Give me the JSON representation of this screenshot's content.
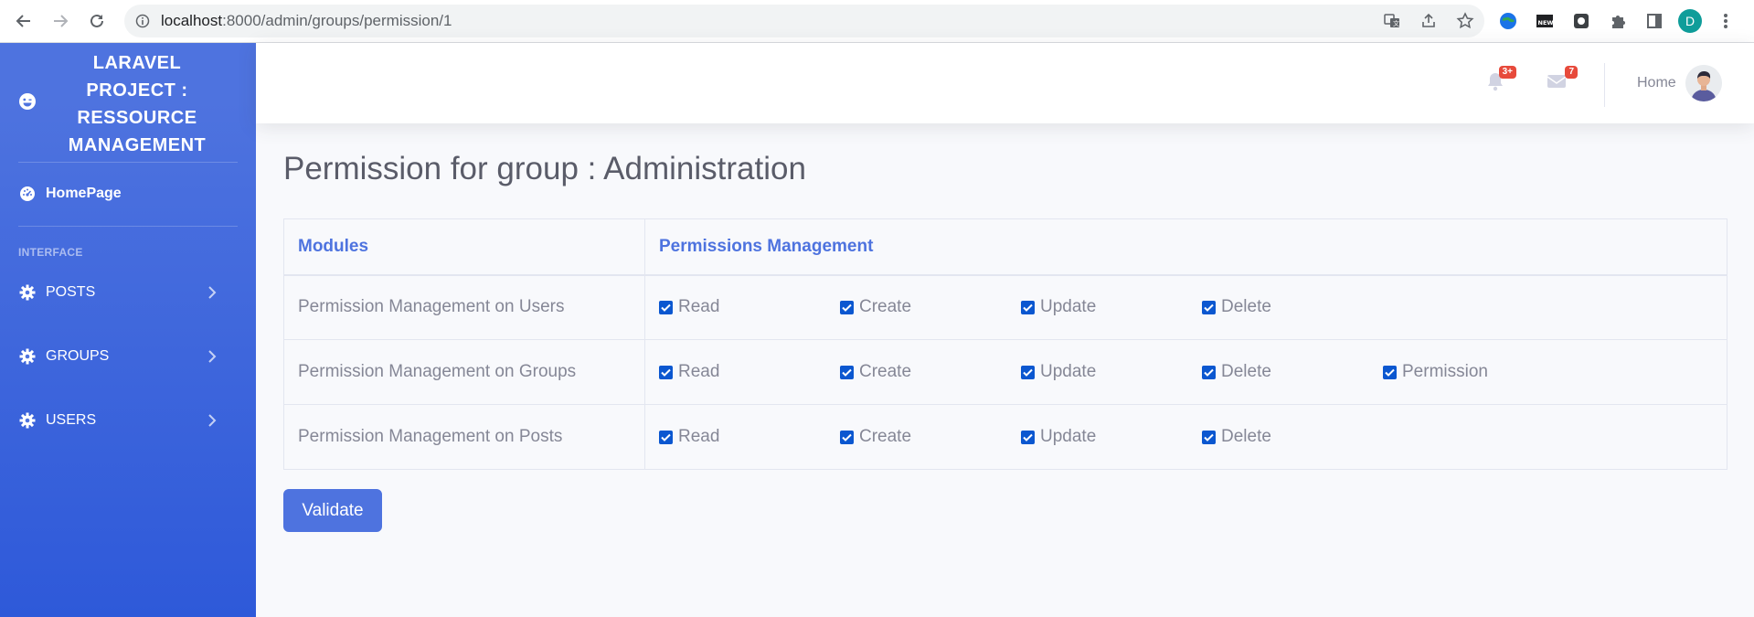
{
  "browser": {
    "url_host": "localhost",
    "url_path": ":8000/admin/groups/permission/1",
    "profile_initial": "D"
  },
  "sidebar": {
    "brand_title": "LARAVEL PROJECT : RESSOURCE MANAGEMENT",
    "home_label": "HomePage",
    "heading": "INTERFACE",
    "items": [
      {
        "label": "POSTS",
        "icon": "cog-icon"
      },
      {
        "label": "GROUPS",
        "icon": "cog-icon"
      },
      {
        "label": "USERS",
        "icon": "cog-icon"
      }
    ]
  },
  "topbar": {
    "alerts_badge": "3+",
    "messages_badge": "7",
    "user_name": "Home"
  },
  "page": {
    "title": "Permission for group : Administration",
    "table_headers": [
      "Modules",
      "Permissions Management"
    ],
    "rows": [
      {
        "module": "Permission Management on Users",
        "permissions": [
          "Read",
          "Create",
          "Update",
          "Delete"
        ],
        "checked": [
          true,
          true,
          true,
          true
        ]
      },
      {
        "module": "Permission Management on Groups",
        "permissions": [
          "Read",
          "Create",
          "Update",
          "Delete",
          "Permission"
        ],
        "checked": [
          true,
          true,
          true,
          true,
          true
        ]
      },
      {
        "module": "Permission Management on Posts",
        "permissions": [
          "Read",
          "Create",
          "Update",
          "Delete"
        ],
        "checked": [
          true,
          true,
          true,
          true
        ]
      }
    ],
    "submit_label": "Validate"
  },
  "colors": {
    "primary": "#4e73df",
    "sidebar_gradient_end": "#2e59d9",
    "badge": "#e74a3b",
    "checkbox": "#0b57d0"
  }
}
